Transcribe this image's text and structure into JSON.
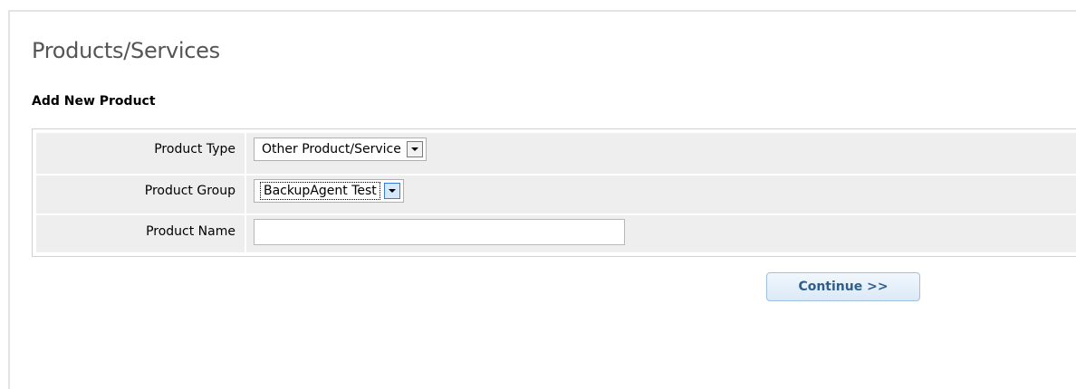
{
  "page": {
    "title": "Products/Services",
    "section_title": "Add New Product"
  },
  "form": {
    "product_type": {
      "label": "Product Type",
      "value": "Other Product/Service"
    },
    "product_group": {
      "label": "Product Group",
      "value": "BackupAgent Test"
    },
    "product_name": {
      "label": "Product Name",
      "value": "",
      "placeholder": ""
    }
  },
  "actions": {
    "continue_label": "Continue >>"
  },
  "colors": {
    "form_background": "#eeeeee",
    "button_text": "#2f5e8c",
    "title_text": "#555555"
  }
}
